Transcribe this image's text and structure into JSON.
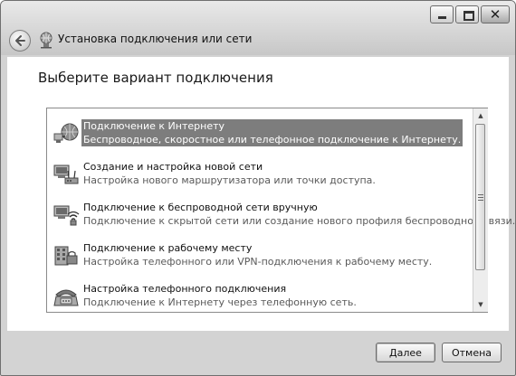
{
  "window": {
    "title": "Установка подключения или сети",
    "caption": {
      "close_glyph": "✕"
    }
  },
  "content": {
    "heading": "Выберите вариант подключения"
  },
  "options": [
    {
      "title": "Подключение к Интернету",
      "subtitle": "Беспроводное, скоростное или телефонное подключение к Интернету.",
      "icon": "globe-network-icon",
      "selected": true
    },
    {
      "title": "Создание и настройка новой сети",
      "subtitle": "Настройка нового маршрутизатора или точки доступа.",
      "icon": "network-router-icon",
      "selected": false
    },
    {
      "title": "Подключение к беспроводной сети вручную",
      "subtitle": "Подключение к скрытой сети или создание нового профиля беспроводной связи.",
      "icon": "wireless-network-icon",
      "selected": false
    },
    {
      "title": "Подключение к рабочему месту",
      "subtitle": "Настройка телефонного или VPN-подключения к рабочему месту.",
      "icon": "workplace-icon",
      "selected": false
    },
    {
      "title": "Настройка телефонного подключения",
      "subtitle": "Подключение к Интернету через телефонную сеть.",
      "icon": "phone-icon",
      "selected": false
    }
  ],
  "scrollbar": {
    "up_glyph": "▲",
    "down_glyph": "▼"
  },
  "buttons": {
    "next": "Далее",
    "cancel": "Отмена"
  }
}
